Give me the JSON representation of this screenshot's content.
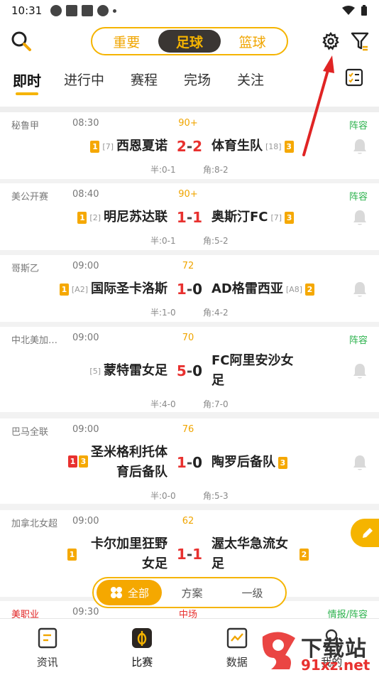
{
  "status_bar": {
    "time": "10:31"
  },
  "header": {
    "segments": [
      "重要",
      "足球",
      "篮球"
    ],
    "active_segment": "足球"
  },
  "tabs": [
    "即时",
    "进行中",
    "赛程",
    "完场",
    "关注"
  ],
  "matches": [
    {
      "league": "秘鲁甲",
      "time": "08:30",
      "status": "90+",
      "tag": "阵容",
      "home": {
        "name": "西恩夏诺",
        "rank": "[7]",
        "badges": [
          "1"
        ]
      },
      "away": {
        "name": "体育生队",
        "rank": "[18]",
        "badges": [
          "3"
        ]
      },
      "score_home": "2",
      "score_away": "2",
      "away_red": true,
      "half": "半:0-1",
      "corner": "角:8-2"
    },
    {
      "league": "美公开赛",
      "time": "08:40",
      "status": "90+",
      "tag": "阵容",
      "home": {
        "name": "明尼苏达联",
        "rank": "[2]",
        "badges": [
          "1"
        ]
      },
      "away": {
        "name": "奥斯汀FC",
        "rank": "[7]",
        "badges": [
          "3"
        ]
      },
      "score_home": "1",
      "score_away": "1",
      "away_red": true,
      "half": "半:0-1",
      "corner": "角:5-2"
    },
    {
      "league": "哥斯乙",
      "time": "09:00",
      "status": "72",
      "tag": "",
      "home": {
        "name": "国际圣卡洛斯",
        "rank": "[A2]",
        "badges": [
          "1"
        ]
      },
      "away": {
        "name": "AD格雷西亚",
        "rank": "[A8]",
        "badges": [
          "2"
        ]
      },
      "score_home": "1",
      "score_away": "0",
      "away_red": false,
      "half": "半:1-0",
      "corner": "角:4-2"
    },
    {
      "league": "中北美加…",
      "time": "09:00",
      "status": "70",
      "tag": "阵容",
      "home": {
        "name": "蒙特雷女足",
        "rank": "[5]",
        "badges": []
      },
      "away": {
        "name_line1": "FC阿里安沙女",
        "name_line2": "足",
        "rank": "",
        "badges": []
      },
      "score_home": "5",
      "score_away": "0",
      "away_red": false,
      "half": "半:4-0",
      "corner": "角:7-0"
    },
    {
      "league": "巴马全联",
      "time": "09:00",
      "status": "76",
      "tag": "",
      "home": {
        "name_line1": "圣米格利托体",
        "name_line2": "育后备队",
        "rank": "",
        "badges": [
          "1",
          "3"
        ]
      },
      "away": {
        "name": "陶罗后备队",
        "rank": "",
        "badges": [
          "3"
        ]
      },
      "score_home": "1",
      "score_away": "0",
      "away_red": false,
      "half": "半:0-0",
      "corner": "角:5-3"
    },
    {
      "league": "加拿北女超",
      "time": "09:00",
      "status": "62",
      "tag": "",
      "home": {
        "name_line1": "卡尔加里狂野",
        "name_line2": "女足",
        "rank": "",
        "badges": [
          "1"
        ]
      },
      "away": {
        "name_line1": "渥太华急流女",
        "name_line2": "足",
        "rank": "",
        "badges": [
          "2"
        ]
      },
      "score_home": "1",
      "score_away": "1",
      "away_red": true,
      "half": "",
      "corner": ""
    },
    {
      "league": "美职业",
      "time": "09:30",
      "status": "中场",
      "tag": "情报/阵容"
    }
  ],
  "filter_pill": [
    "全部",
    "方案",
    "一级"
  ],
  "bottom_nav": [
    "资讯",
    "比赛",
    "数据",
    "我的"
  ],
  "watermark": {
    "line1": "下载站",
    "line2": "91xz.net"
  }
}
